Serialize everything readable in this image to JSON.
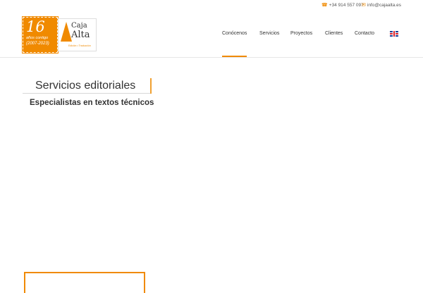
{
  "topbar": {
    "phone": "+34 914 557 097",
    "email": "info@cajaalta.es"
  },
  "logo": {
    "badge_number": "16",
    "badge_line1": "años contigo",
    "badge_line2": "(2007-2023)",
    "word1": "Caja",
    "word2": "Alta",
    "tagline": "Edición • Traducción",
    "accent_color": "#f08a00"
  },
  "nav": {
    "items": [
      "Conócenos",
      "Servicios",
      "Proyectos",
      "Clientes",
      "Contacto"
    ],
    "active": "Conócenos",
    "language_flag": "uk-flag-icon"
  },
  "main": {
    "title": "Servicios editoriales",
    "subtitle": "Especialistas en textos técnicos"
  }
}
